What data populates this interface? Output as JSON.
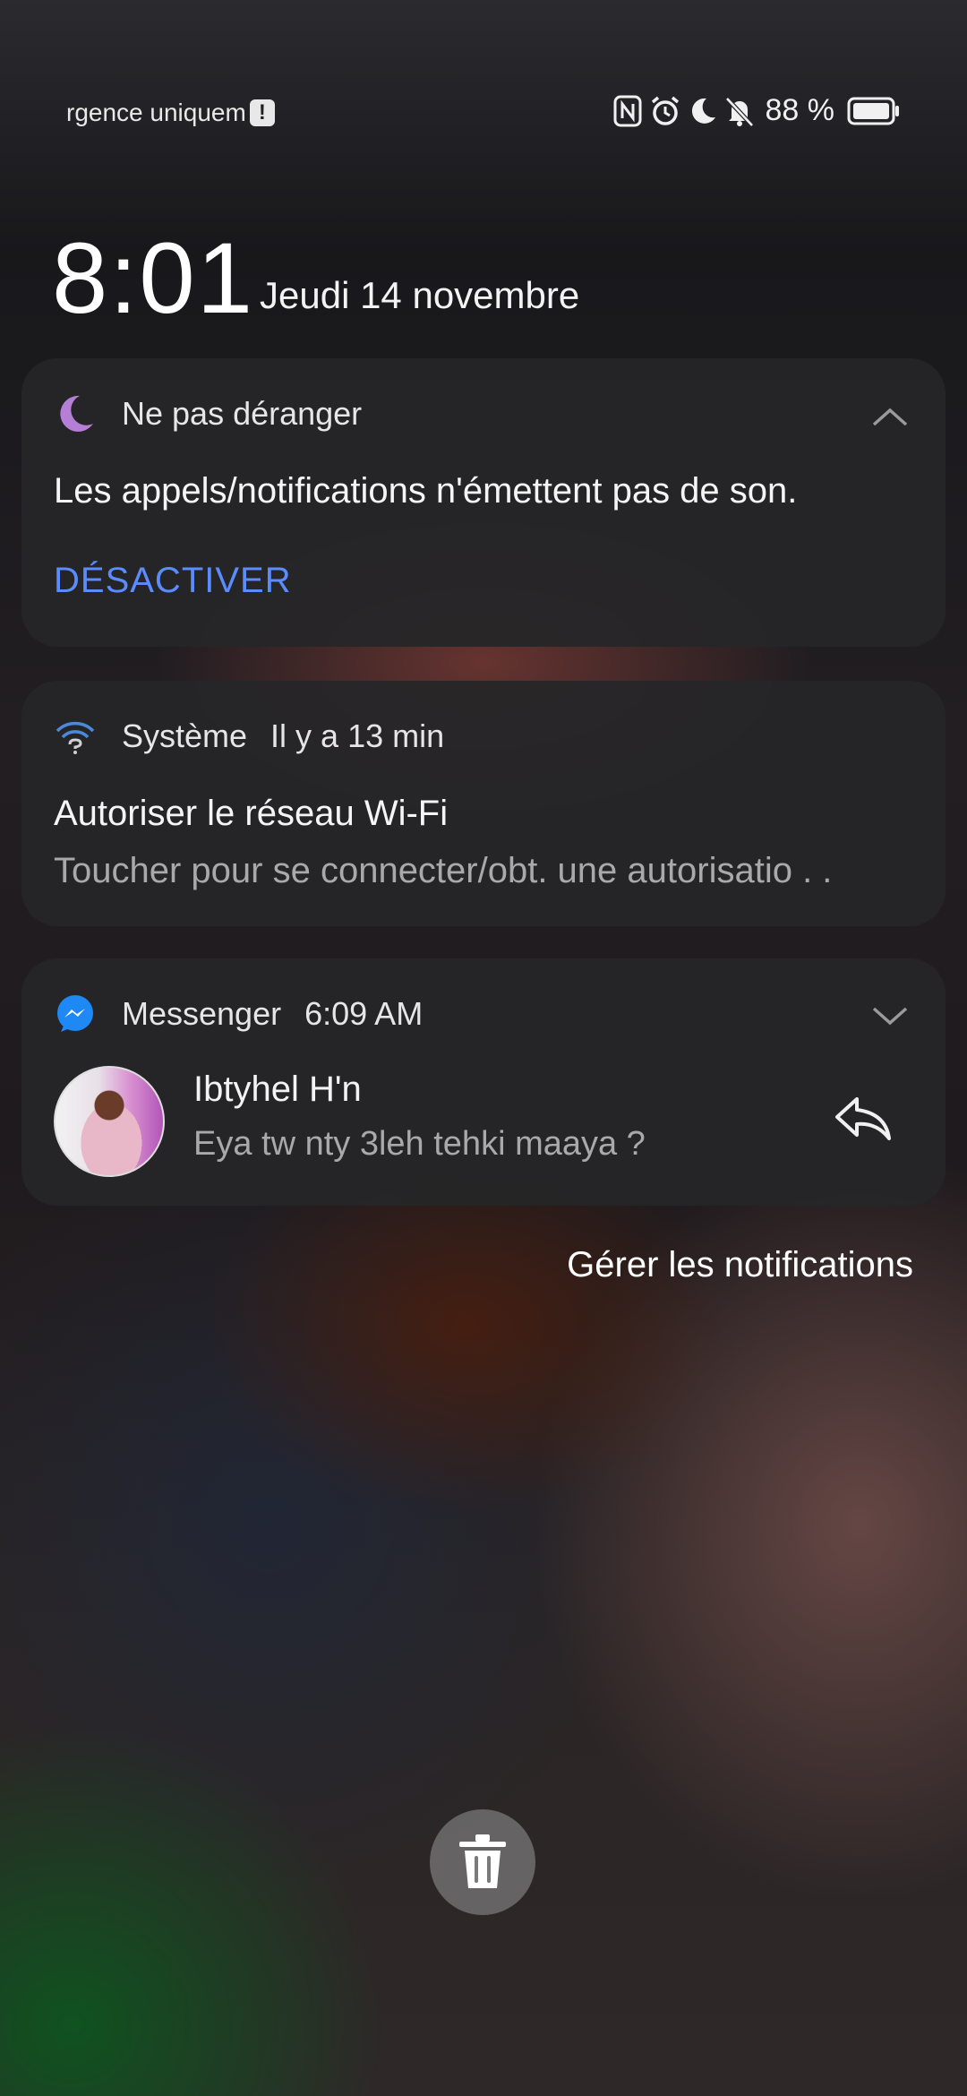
{
  "status_bar": {
    "carrier_text": "rgence uniquem",
    "battery_percent": "88 %",
    "icons": [
      "alert-icon",
      "nfc-icon",
      "alarm-icon",
      "moon-icon",
      "bell-off-icon",
      "battery-icon"
    ]
  },
  "lockscreen": {
    "time": "8:01",
    "date": "Jeudi 14 novembre"
  },
  "notifications": {
    "dnd": {
      "icon": "moon-icon",
      "title": "Ne pas déranger",
      "body": "Les appels/notifications n'émettent pas de son.",
      "action": "DÉSACTIVER",
      "accent": "#5b8cff",
      "icon_color": "#b57fd8"
    },
    "system": {
      "icon": "wifi-question-icon",
      "app": "Système",
      "time": "Il y a 13 min",
      "title": "Autoriser le réseau Wi-Fi",
      "text": "Toucher pour se connecter/obt. une autorisatio . ."
    },
    "messenger": {
      "icon": "messenger-icon",
      "app": "Messenger",
      "time": "6:09 AM",
      "sender": "Ibtyhel H'n",
      "message": "Eya tw nty 3leh tehki maaya ?",
      "brand_color": "#1e88f5"
    }
  },
  "manage_label": "Gérer les notifications",
  "clear_icon": "trash-icon"
}
